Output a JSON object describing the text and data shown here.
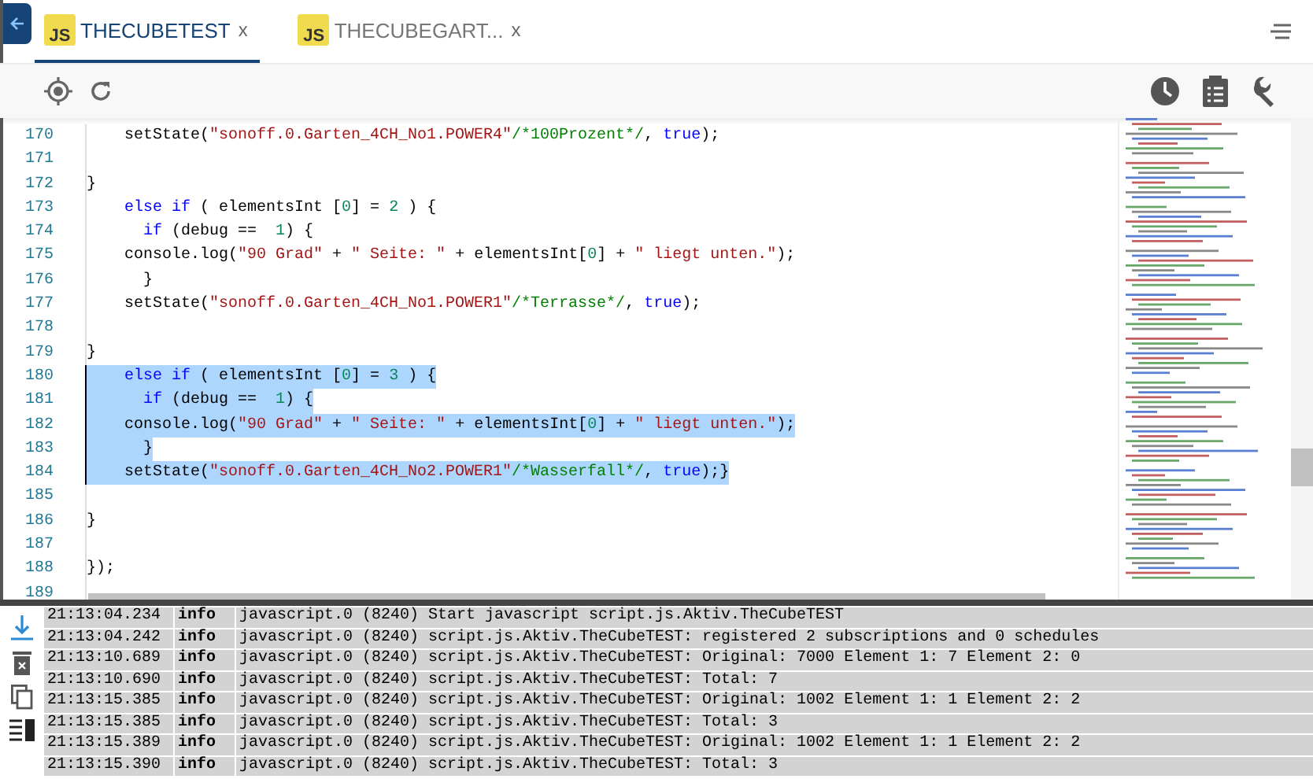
{
  "tabs": [
    {
      "badge": "JS",
      "label": "THECUBETEST",
      "close": "x",
      "selected": true
    },
    {
      "badge": "JS",
      "label": "THECUBEGART...",
      "close": "x",
      "selected": false
    }
  ],
  "editor": {
    "lines": [
      {
        "number": "170",
        "selected": false,
        "tokens": [
          {
            "kind": "plain",
            "text": "    setState("
          },
          {
            "kind": "string",
            "text": "\"sonoff.0.Garten_4CH_No1.POWER4\""
          },
          {
            "kind": "comment",
            "text": "/*100Prozent*/"
          },
          {
            "kind": "plain",
            "text": ", "
          },
          {
            "kind": "keyword",
            "text": "true"
          },
          {
            "kind": "plain",
            "text": ");"
          }
        ]
      },
      {
        "number": "171",
        "selected": false
      },
      {
        "number": "172",
        "selected": false,
        "tokens": [
          {
            "kind": "plain",
            "text": "}"
          }
        ]
      },
      {
        "number": "173",
        "selected": false,
        "tokens": [
          {
            "kind": "keyword",
            "text": "    else if"
          },
          {
            "kind": "plain",
            "text": " ( elementsInt ["
          },
          {
            "kind": "number",
            "text": "0"
          },
          {
            "kind": "plain",
            "text": "] = "
          },
          {
            "kind": "number",
            "text": "2"
          },
          {
            "kind": "plain",
            "text": " ) {"
          }
        ]
      },
      {
        "number": "174",
        "selected": false,
        "tokens": [
          {
            "kind": "keyword",
            "text": "      if"
          },
          {
            "kind": "plain",
            "text": " (debug ==  "
          },
          {
            "kind": "number",
            "text": "1"
          },
          {
            "kind": "plain",
            "text": ") {"
          }
        ]
      },
      {
        "number": "175",
        "selected": false,
        "tokens": [
          {
            "kind": "plain",
            "text": "    console.log("
          },
          {
            "kind": "string",
            "text": "\"90 Grad\""
          },
          {
            "kind": "plain",
            "text": " + "
          },
          {
            "kind": "string",
            "text": "\" Seite: \""
          },
          {
            "kind": "plain",
            "text": " + elementsInt["
          },
          {
            "kind": "number",
            "text": "0"
          },
          {
            "kind": "plain",
            "text": "] + "
          },
          {
            "kind": "string",
            "text": "\" liegt unten.\""
          },
          {
            "kind": "plain",
            "text": ");"
          }
        ]
      },
      {
        "number": "176",
        "selected": false,
        "tokens": [
          {
            "kind": "plain",
            "text": "      }"
          }
        ]
      },
      {
        "number": "177",
        "selected": false,
        "tokens": [
          {
            "kind": "plain",
            "text": "    setState("
          },
          {
            "kind": "string",
            "text": "\"sonoff.0.Garten_4CH_No1.POWER1\""
          },
          {
            "kind": "comment",
            "text": "/*Terrasse*/"
          },
          {
            "kind": "plain",
            "text": ", "
          },
          {
            "kind": "keyword",
            "text": "true"
          },
          {
            "kind": "plain",
            "text": ");"
          }
        ]
      },
      {
        "number": "178",
        "selected": false
      },
      {
        "number": "179",
        "selected": false,
        "tokens": [
          {
            "kind": "plain",
            "text": "}"
          }
        ]
      },
      {
        "number": "180",
        "selected": true,
        "tokens": [
          {
            "kind": "keyword",
            "text": "    else if"
          },
          {
            "kind": "plain",
            "text": " ( elementsInt ["
          },
          {
            "kind": "number",
            "text": "0"
          },
          {
            "kind": "plain",
            "text": "] = "
          },
          {
            "kind": "number",
            "text": "3"
          },
          {
            "kind": "plain",
            "text": " ) {"
          }
        ]
      },
      {
        "number": "181",
        "selected": true,
        "tokens": [
          {
            "kind": "keyword",
            "text": "      if"
          },
          {
            "kind": "plain",
            "text": " (debug ==  "
          },
          {
            "kind": "number",
            "text": "1"
          },
          {
            "kind": "plain",
            "text": ") {"
          }
        ]
      },
      {
        "number": "182",
        "selected": true,
        "tokens": [
          {
            "kind": "plain",
            "text": "    console.log("
          },
          {
            "kind": "string",
            "text": "\"90 Grad\""
          },
          {
            "kind": "plain",
            "text": " + "
          },
          {
            "kind": "string",
            "text": "\" Seite: \""
          },
          {
            "kind": "plain",
            "text": " + elementsInt["
          },
          {
            "kind": "number",
            "text": "0"
          },
          {
            "kind": "plain",
            "text": "] + "
          },
          {
            "kind": "string",
            "text": "\" liegt unten.\""
          },
          {
            "kind": "plain",
            "text": ");"
          }
        ]
      },
      {
        "number": "183",
        "selected": true,
        "tokens": [
          {
            "kind": "plain",
            "text": "      }"
          }
        ]
      },
      {
        "number": "184",
        "selected": true,
        "tokens": [
          {
            "kind": "plain",
            "text": "    setState("
          },
          {
            "kind": "string",
            "text": "\"sonoff.0.Garten_4CH_No2.POWER1\""
          },
          {
            "kind": "comment",
            "text": "/*Wasserfall*/"
          },
          {
            "kind": "plain",
            "text": ", "
          },
          {
            "kind": "keyword",
            "text": "true"
          },
          {
            "kind": "plain",
            "text": ");}"
          }
        ]
      },
      {
        "number": "185",
        "selected": false
      },
      {
        "number": "186",
        "selected": false,
        "tokens": [
          {
            "kind": "plain",
            "text": "}"
          }
        ]
      },
      {
        "number": "187",
        "selected": false
      },
      {
        "number": "188",
        "selected": false,
        "tokens": [
          {
            "kind": "plain",
            "text": "});"
          }
        ]
      },
      {
        "number": "189",
        "selected": false
      }
    ]
  },
  "log": [
    {
      "time": "21:13:04.234",
      "level": "info",
      "message": "javascript.0 (8240) Start javascript script.js.Aktiv.TheCubeTEST"
    },
    {
      "time": "21:13:04.242",
      "level": "info",
      "message": "javascript.0 (8240) script.js.Aktiv.TheCubeTEST: registered 2 subscriptions and 0 schedules"
    },
    {
      "time": "21:13:10.689",
      "level": "info",
      "message": "javascript.0 (8240) script.js.Aktiv.TheCubeTEST: Original: 7000 Element 1: 7 Element 2: 0"
    },
    {
      "time": "21:13:10.690",
      "level": "info",
      "message": "javascript.0 (8240) script.js.Aktiv.TheCubeTEST: Total: 7"
    },
    {
      "time": "21:13:15.385",
      "level": "info",
      "message": "javascript.0 (8240) script.js.Aktiv.TheCubeTEST: Original: 1002 Element 1: 1 Element 2: 2"
    },
    {
      "time": "21:13:15.385",
      "level": "info",
      "message": "javascript.0 (8240) script.js.Aktiv.TheCubeTEST: Total: 3"
    },
    {
      "time": "21:13:15.389",
      "level": "info",
      "message": "javascript.0 (8240) script.js.Aktiv.TheCubeTEST: Original: 1002 Element 1: 1 Element 2: 2"
    },
    {
      "time": "21:13:15.390",
      "level": "info",
      "message": "javascript.0 (8240) script.js.Aktiv.TheCubeTEST: Total: 3"
    }
  ]
}
